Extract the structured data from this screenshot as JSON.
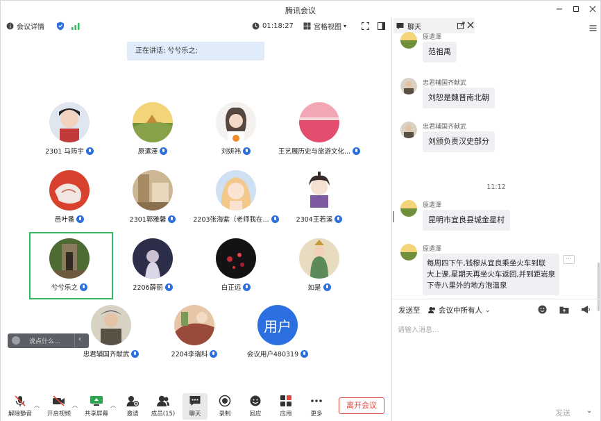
{
  "window": {
    "title": "腾讯会议"
  },
  "topbar": {
    "meeting_details": "会议详情",
    "timer": "01:18:27",
    "view": "宫格视图"
  },
  "speaking": {
    "label": "正在讲话: 兮兮乐之;"
  },
  "participants": [
    {
      "name": "2301 马筠宇"
    },
    {
      "name": "原遣澤"
    },
    {
      "name": "刘妍祎"
    },
    {
      "name": "王艺展历史与旅游文化..."
    },
    {
      "name": "邑叶番"
    },
    {
      "name": "2301郭雅馨"
    },
    {
      "name": "2203张海紫（老师我在..."
    },
    {
      "name": "2304王若溪"
    },
    {
      "name": "兮兮乐之"
    },
    {
      "name": "2206薛丽"
    },
    {
      "name": "白正远"
    },
    {
      "name": "如是"
    },
    {
      "name": "忠君辅国齐献武"
    },
    {
      "name": "2204李瑞科"
    },
    {
      "name": "会议用户480319",
      "avatar_text": "用户"
    }
  ],
  "chat_input": {
    "placeholder": "说点什么..."
  },
  "bottom": {
    "mute": "解除静音",
    "video": "开启视频",
    "share": "共享屏幕",
    "invite": "邀请",
    "members": "成员(15)",
    "chat": "聊天",
    "record": "录制",
    "react": "回应",
    "apps": "应用",
    "more": "更多",
    "leave": "离开会议"
  },
  "chat": {
    "tab": "聊天",
    "timestamp": "11:12",
    "messages": [
      {
        "sender": "原遣澤",
        "text": "范祖禹"
      },
      {
        "sender": "忠君辅国齐献武",
        "text": "刘恕是魏晋南北朝"
      },
      {
        "sender": "忠君辅国齐献武",
        "text": "刘颁负责汉史部分"
      },
      {
        "sender": "原遣澤",
        "text": "昆明市宜良县城金星村"
      },
      {
        "sender": "原遣澤",
        "lines": [
          "每周四下午,钱穆从宜良乘坐火车到联",
          "大上课,星期天再坐火车返回,并到距岩泉",
          "下寺八里外的地方泡温泉"
        ]
      }
    ],
    "send_to_label": "发送至",
    "send_to_target": "会议中所有人",
    "input_placeholder": "请输入消息...",
    "send": "发送"
  }
}
